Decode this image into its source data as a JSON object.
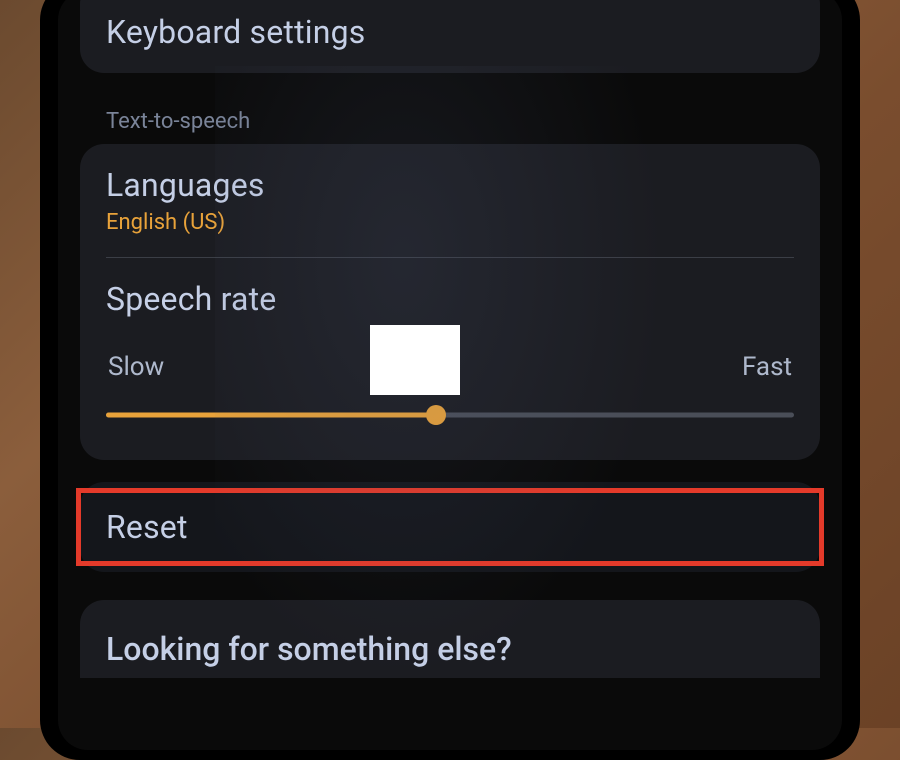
{
  "keyboard": {
    "title": "Keyboard settings"
  },
  "tts": {
    "section_label": "Text-to-speech",
    "languages_title": "Languages",
    "languages_value": "English (US)",
    "speech_rate_title": "Speech rate",
    "slow_label": "Slow",
    "fast_label": "Fast",
    "slider_percent": 48
  },
  "reset": {
    "title": "Reset"
  },
  "footer": {
    "title": "Looking for something else?"
  },
  "colors": {
    "accent": "#e8a23a",
    "highlight": "#e43a2a"
  }
}
